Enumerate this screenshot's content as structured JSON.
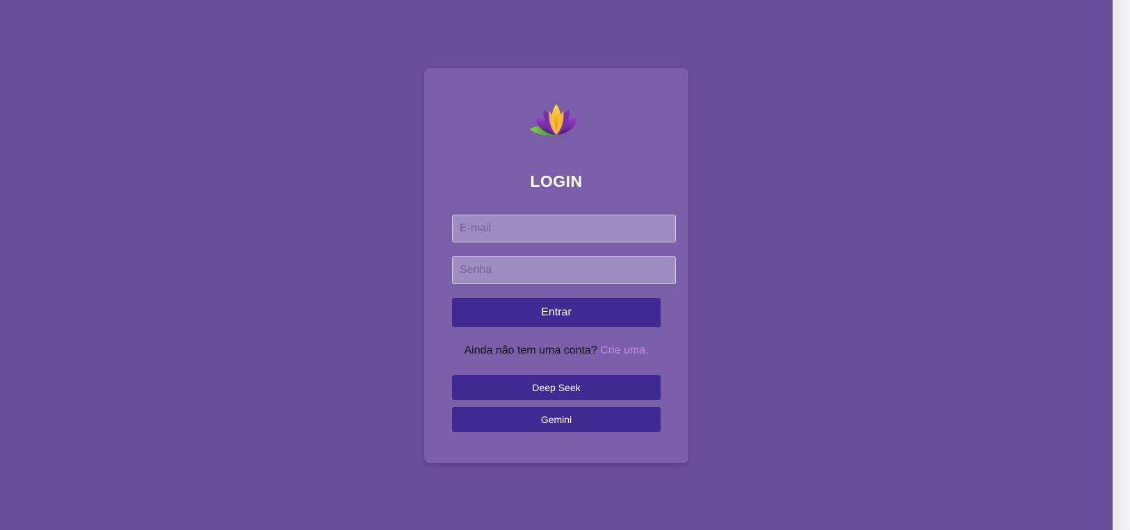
{
  "login": {
    "title": "LOGIN",
    "email_placeholder": "E-mail",
    "password_placeholder": "Senha",
    "submit_label": "Entrar",
    "signup_prompt": "Ainda não tem uma conta?",
    "signup_link": "Crie uma."
  },
  "actions": {
    "deepseek_label": "Deep Seek",
    "gemini_label": "Gemini"
  },
  "logo": {
    "icon": "lotus-icon"
  },
  "colors": {
    "background": "#694e9c",
    "card": "#7a5ea8",
    "button": "#3f2a92",
    "link": "#c18ee6"
  }
}
